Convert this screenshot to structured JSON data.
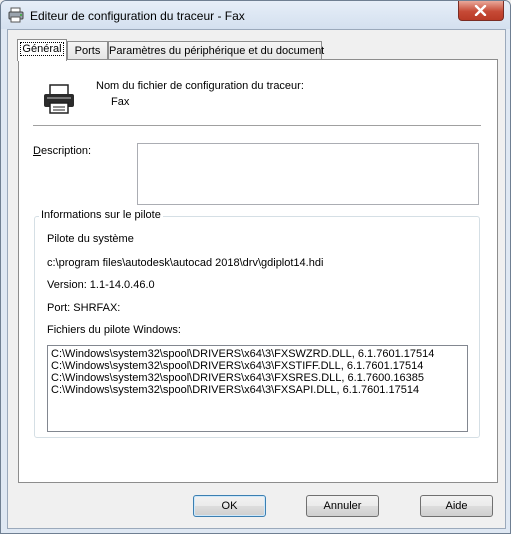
{
  "window": {
    "title": "Editeur de configuration du traceur - Fax"
  },
  "tabs": [
    {
      "label": "Général",
      "active": true
    },
    {
      "label": "Ports",
      "active": false
    },
    {
      "label": "Paramètres du périphérique et du document",
      "active": false
    }
  ],
  "general": {
    "config_file_label": "Nom du fichier de configuration du traceur:",
    "config_file_value": "Fax",
    "description_label": "Description:",
    "description_value": "",
    "driver_group_title": "Informations sur le pilote",
    "system_driver_label": "Pilote du système",
    "driver_path": "c:\\program files\\autodesk\\autocad 2018\\drv\\gdiplot14.hdi",
    "version_text": "Version: 1.1-14.0.46.0",
    "port_text": "Port: SHRFAX:",
    "windows_driver_files_label": "Fichiers du pilote Windows:",
    "windows_driver_files": [
      "C:\\Windows\\system32\\spool\\DRIVERS\\x64\\3\\FXSWZRD.DLL, 6.1.7601.17514",
      "C:\\Windows\\system32\\spool\\DRIVERS\\x64\\3\\FXSTIFF.DLL, 6.1.7601.17514",
      "C:\\Windows\\system32\\spool\\DRIVERS\\x64\\3\\FXSRES.DLL, 6.1.7600.16385",
      "C:\\Windows\\system32\\spool\\DRIVERS\\x64\\3\\FXSAPI.DLL, 6.1.7601.17514"
    ]
  },
  "buttons": {
    "ok": "OK",
    "cancel": "Annuler",
    "help": "Aide"
  },
  "icons": {
    "app": "plotter-config-icon",
    "printer": "printer-icon",
    "close": "close-icon"
  },
  "colors": {
    "close_button": "#c64a36",
    "titlebar": "#dfe8f3",
    "default_button_border": "#3c7fb1"
  }
}
